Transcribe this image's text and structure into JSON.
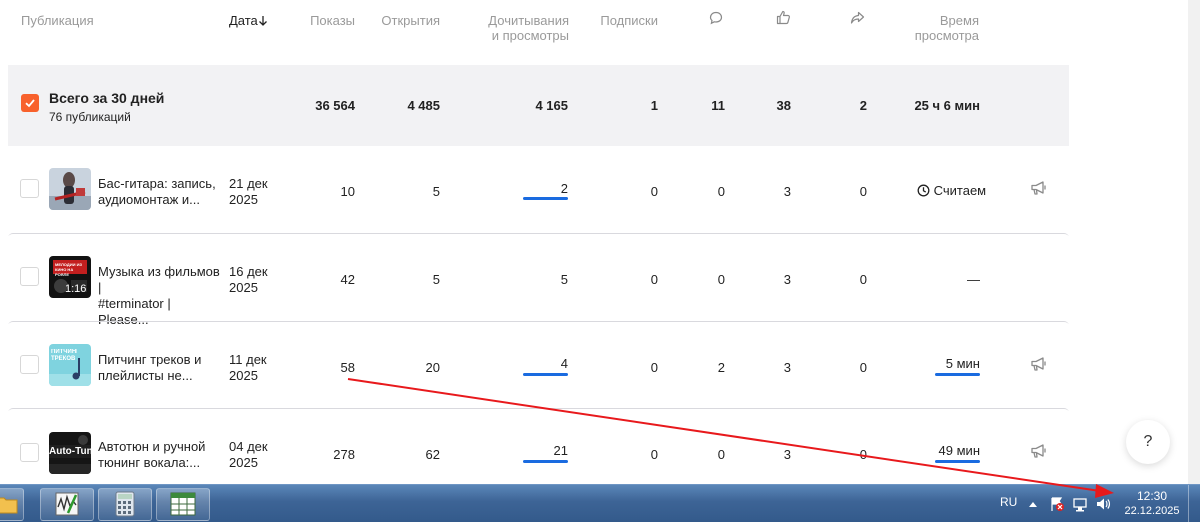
{
  "header": {
    "publication": "Публикация",
    "date": "Дата",
    "views": "Показы",
    "opens": "Открытия",
    "reads_line1": "Дочитывания",
    "reads_line2": "и просмотры",
    "subscriptions": "Подписки",
    "time_line1": "Время",
    "time_line2": "просмотра"
  },
  "total": {
    "title": "Всего за 30 дней",
    "subtitle": "76 публикаций",
    "views": "36 564",
    "opens": "4 485",
    "reads": "4 165",
    "subscriptions": "1",
    "comments": "11",
    "likes": "38",
    "reposts": "2",
    "time": "25 ч 6 мин"
  },
  "rows": [
    {
      "title_line1": "Бас-гитара: запись,",
      "title_line2": "аудиомонтаж и...",
      "date_line1": "21 дек",
      "date_line2": "2025",
      "views": "10",
      "opens": "5",
      "reads": "2",
      "subscriptions": "0",
      "comments": "0",
      "likes": "3",
      "reposts": "0",
      "time": "Считаем"
    },
    {
      "title_line1": "Музыка из фильмов |",
      "title_line2": "#terminator | Please...",
      "date_line1": "16 дек",
      "date_line2": "2025",
      "thumb_badge": "1:16",
      "thumb_caption": "МЕЛОДИИ ИЗ КИНО НА РОЯЛЕ",
      "views": "42",
      "opens": "5",
      "reads": "5",
      "subscriptions": "0",
      "comments": "0",
      "likes": "3",
      "reposts": "0",
      "time": "—"
    },
    {
      "title_line1": "Питчинг треков и",
      "title_line2": "плейлисты не...",
      "date_line1": "11 дек",
      "date_line2": "2025",
      "thumb_caption": "ПИТЧИНГ ТРЕКОВ",
      "views": "58",
      "opens": "20",
      "reads": "4",
      "subscriptions": "0",
      "comments": "2",
      "likes": "3",
      "reposts": "0",
      "time": "5 мин"
    },
    {
      "title_line1": "Автотюн и ручной",
      "title_line2": "тюнинг вокала:...",
      "date_line1": "04 дек",
      "date_line2": "2025",
      "thumb_caption": "Auto-Tune",
      "views": "278",
      "opens": "62",
      "reads": "21",
      "subscriptions": "0",
      "comments": "0",
      "likes": "3",
      "reposts": "0",
      "time": "49 мин"
    }
  ],
  "help_label": "?",
  "taskbar": {
    "language": "RU",
    "time": "12:30",
    "date": "22.12.2025"
  },
  "colors": {
    "accent_orange": "#f8612c",
    "underline_blue": "#1a6be0",
    "annotation_red": "#e8191c",
    "total_bg": "#f2f2f4"
  },
  "icons": {
    "comments": "speech-bubble-icon",
    "likes": "thumbs-up-icon",
    "reposts": "share-arrow-icon",
    "promote": "megaphone-icon",
    "pending": "clock-icon"
  }
}
